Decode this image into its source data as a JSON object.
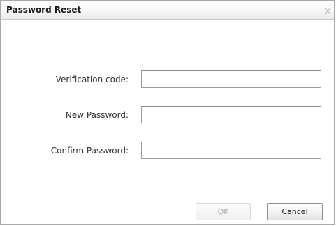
{
  "dialog": {
    "title": "Password Reset",
    "close_icon": "close-icon"
  },
  "form": {
    "verification_code": {
      "label": "Verification code:",
      "value": ""
    },
    "new_password": {
      "label": "New Password:",
      "value": ""
    },
    "confirm_password": {
      "label": "Confirm Password:",
      "value": ""
    }
  },
  "buttons": {
    "ok": {
      "label": "OK",
      "enabled": false
    },
    "cancel": {
      "label": "Cancel",
      "enabled": true
    }
  },
  "colors": {
    "border": "#a9a9a9",
    "disabled_text": "#a8a8a8",
    "label_text": "#333333"
  }
}
